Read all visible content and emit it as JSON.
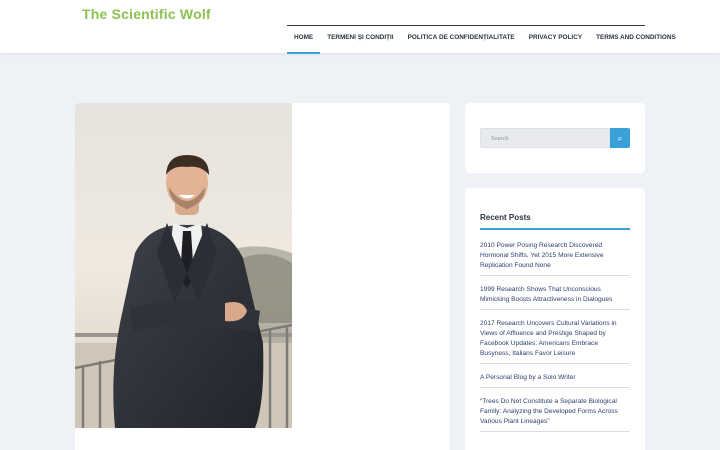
{
  "header": {
    "site_title": "The Scientific Wolf",
    "nav": [
      {
        "label": "HOME",
        "active": true
      },
      {
        "label": "TERMENI ȘI CONDIȚII",
        "active": false
      },
      {
        "label": "POLITICA DE CONFIDENȚIALITATE",
        "active": false
      },
      {
        "label": "PRIVACY POLICY",
        "active": false
      },
      {
        "label": "TERMS AND CONDITIONS",
        "active": false
      }
    ]
  },
  "sidebar": {
    "search": {
      "placeholder": "Search",
      "button_icon": "search-icon"
    },
    "recent_posts": {
      "title": "Recent Posts",
      "items": [
        "2010 Power Posing Research Discovered Hormonal Shifts, Yet 2015 More Extensive Replication Found None",
        "1999 Research Shows That Unconscious Mimicking Boosts Attractiveness in Dialogues",
        "2017 Research Uncovers Cultural Variations in Views of Affluence and Prestige Shaped by Facebook Updates: Americans Embrace Busyness, Italians Favor Leisure",
        "A Personal Blog by a Solo Writer",
        "“Trees Do Not Constitute a Separate Biological Family: Analyzing the Developed Forms Across Various Plant Lineages”"
      ]
    }
  },
  "colors": {
    "site_title": "#8cc152",
    "accent": "#3aa0d8",
    "background": "#eef1f5"
  }
}
